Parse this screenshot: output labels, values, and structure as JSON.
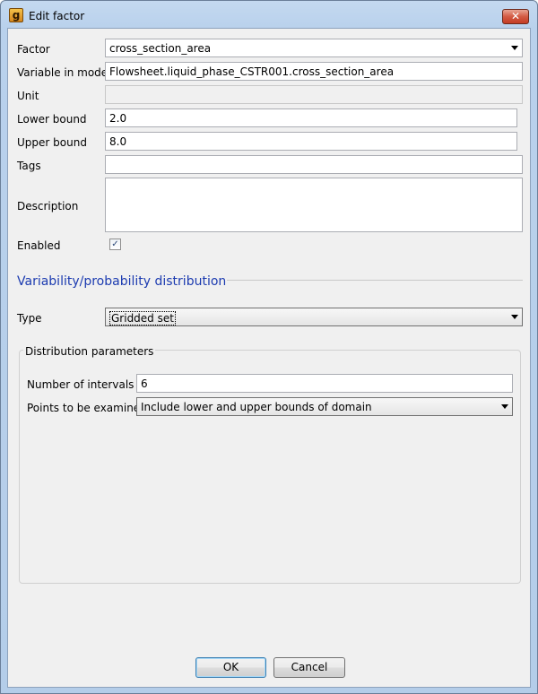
{
  "window": {
    "title": "Edit factor",
    "app_icon_glyph": "g",
    "close_glyph": "✕"
  },
  "form": {
    "factor": {
      "label": "Factor",
      "value": "cross_section_area"
    },
    "variable": {
      "label": "Variable in model",
      "value": "Flowsheet.liquid_phase_CSTR001.cross_section_area"
    },
    "unit": {
      "label": "Unit",
      "value": ""
    },
    "lower_bound": {
      "label": "Lower bound",
      "value": "2.0"
    },
    "upper_bound": {
      "label": "Upper bound",
      "value": "8.0"
    },
    "tags": {
      "label": "Tags",
      "value": ""
    },
    "description": {
      "label": "Description",
      "value": ""
    },
    "enabled": {
      "label": "Enabled",
      "checked": true,
      "check_glyph": "✓"
    }
  },
  "distribution": {
    "section_title": "Variability/probability distribution",
    "type": {
      "label": "Type",
      "value": "Gridded set"
    },
    "params": {
      "group_title": "Distribution parameters",
      "intervals": {
        "label": "Number of intervals",
        "value": "6"
      },
      "points": {
        "label": "Points to be examined",
        "value": "Include lower and upper bounds of domain"
      }
    }
  },
  "buttons": {
    "ok": "OK",
    "cancel": "Cancel"
  }
}
